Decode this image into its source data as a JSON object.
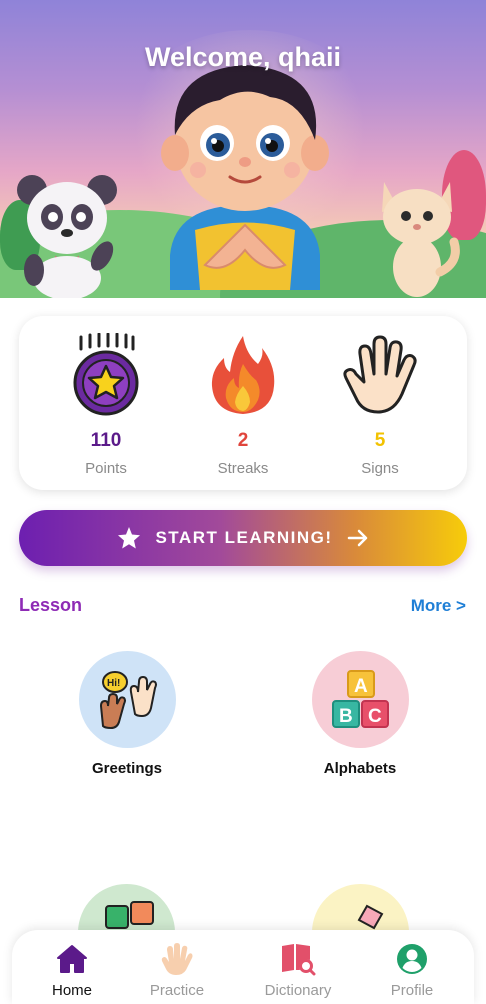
{
  "hero": {
    "title": "Welcome, qhaii"
  },
  "stats": [
    {
      "value": "110",
      "label": "Points",
      "color": "#5b1a8a",
      "icon": "star-medal-icon"
    },
    {
      "value": "2",
      "label": "Streaks",
      "color": "#e0453c",
      "icon": "fire-icon"
    },
    {
      "value": "5",
      "label": "Signs",
      "color": "#f2c200",
      "icon": "hand-icon"
    }
  ],
  "cta": {
    "label": "START LEARNING!"
  },
  "lesson": {
    "title": "Lesson",
    "more": "More >",
    "items": [
      {
        "name": "Greetings",
        "bg": "#cfe3f7",
        "icon": "greeting-hands-icon"
      },
      {
        "name": "Alphabets",
        "bg": "#f7cdd6",
        "icon": "abc-blocks-icon"
      },
      {
        "name": "",
        "bg": "#cfe8cf",
        "icon": "numbers-blocks-icon"
      },
      {
        "name": "",
        "bg": "#fbf3c4",
        "icon": "pencil-icon"
      }
    ]
  },
  "nav": {
    "items": [
      {
        "label": "Home",
        "active": true
      },
      {
        "label": "Practice",
        "active": false
      },
      {
        "label": "Dictionary",
        "active": false
      },
      {
        "label": "Profile",
        "active": false
      }
    ]
  },
  "colors": {
    "accent": "#8e2bb5",
    "link": "#1f7fd6",
    "nav_active": "#5b1a8a"
  }
}
